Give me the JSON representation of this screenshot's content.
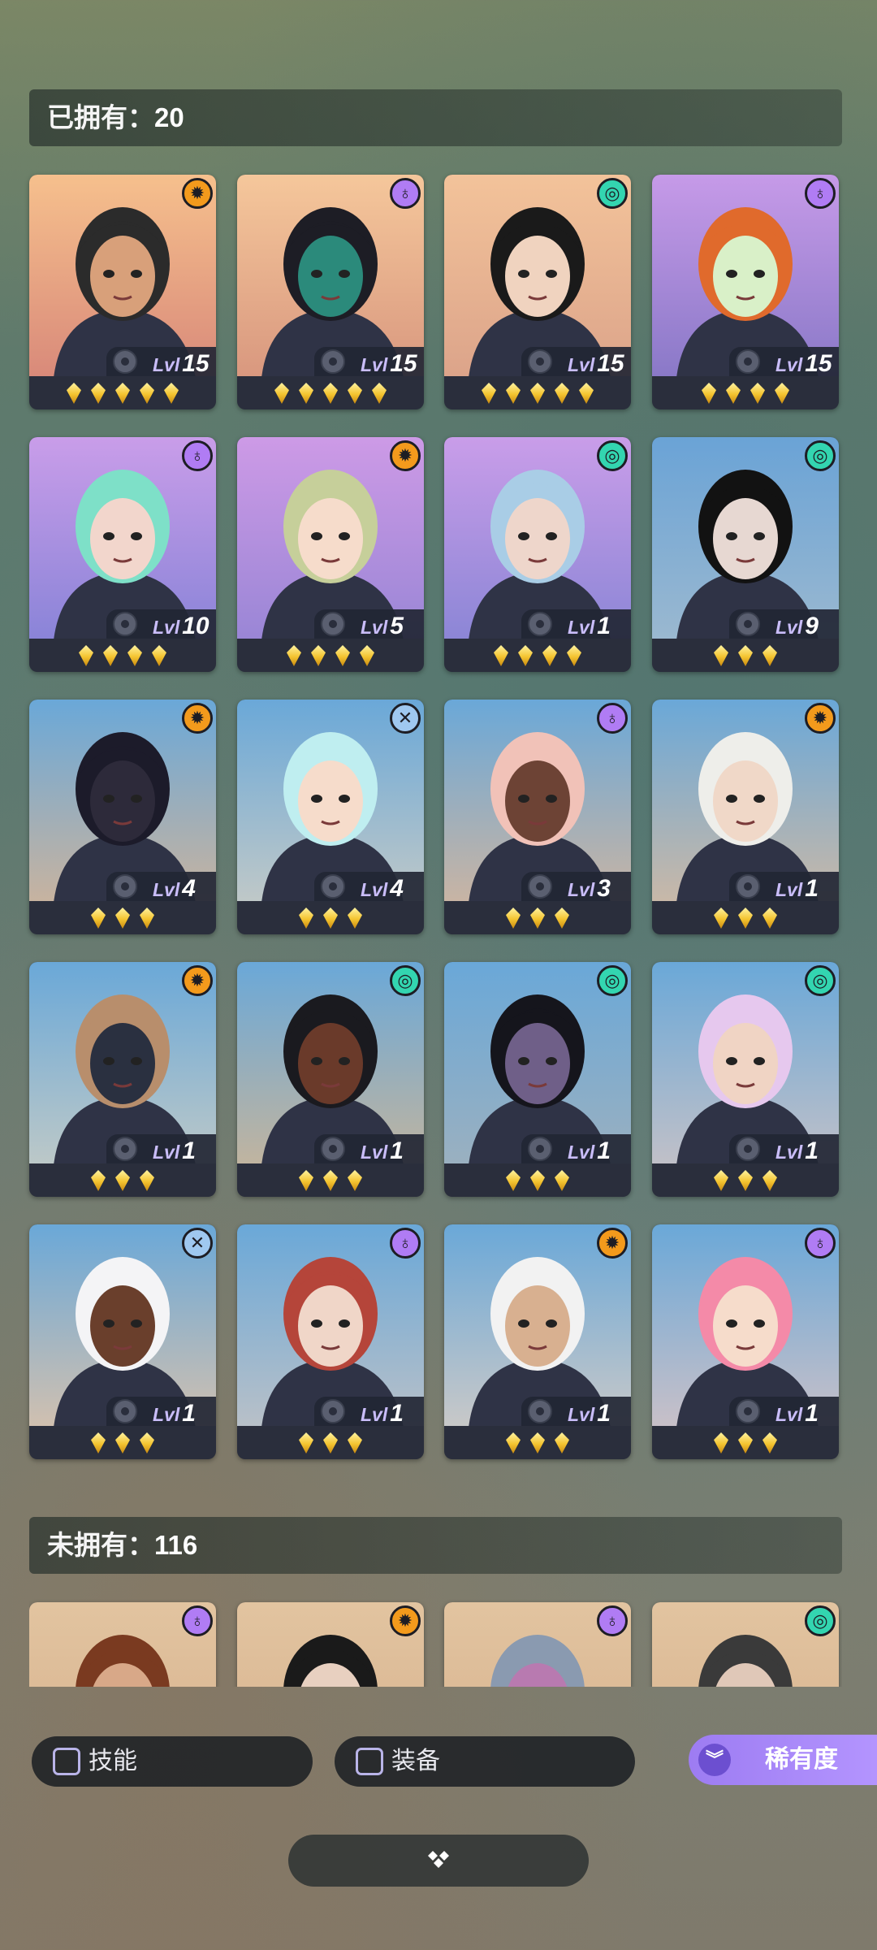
{
  "owned": {
    "label": "已拥有：",
    "count": "20"
  },
  "not_owned": {
    "label": "未拥有：",
    "count": "116"
  },
  "lvl_prefix": "Lvl",
  "owned_heroes": [
    {
      "level": "15",
      "stars": 5,
      "cls": "sun",
      "name_icon": "sun-class-icon",
      "bg": [
        "#f6c08d",
        "#d98a7a"
      ],
      "hair": "#2b2b2b",
      "skin": "#d8a07a"
    },
    {
      "level": "15",
      "stars": 5,
      "cls": "mask",
      "name_icon": "mask-class-icon",
      "bg": [
        "#f5c79b",
        "#d9987f"
      ],
      "hair": "#1d1d25",
      "skin": "#2b8a7b"
    },
    {
      "level": "15",
      "stars": 5,
      "cls": "swirl",
      "name_icon": "swirl-class-icon",
      "bg": [
        "#f3c39a",
        "#dca48a"
      ],
      "hair": "#1a1a1a",
      "skin": "#f0d3bf"
    },
    {
      "level": "15",
      "stars": 4,
      "cls": "mask",
      "name_icon": "mask-class-icon",
      "bg": [
        "#c69ae8",
        "#8a79c8"
      ],
      "hair": "#e06a2c",
      "skin": "#d9f0c8"
    },
    {
      "level": "10",
      "stars": 4,
      "cls": "mask",
      "name_icon": "mask-class-icon",
      "bg": [
        "#c99de9",
        "#8a84d8"
      ],
      "hair": "#7ee0c8",
      "skin": "#f2d6cc"
    },
    {
      "level": "5",
      "stars": 4,
      "cls": "sun",
      "name_icon": "sun-class-icon",
      "bg": [
        "#cd9ae6",
        "#9a86d6"
      ],
      "hair": "#c6cf9a",
      "skin": "#f6dccb"
    },
    {
      "level": "1",
      "stars": 4,
      "cls": "swirl",
      "name_icon": "swirl-class-icon",
      "bg": [
        "#c99de9",
        "#8c86d6"
      ],
      "hair": "#a9cde6",
      "skin": "#eed6cb"
    },
    {
      "level": "9",
      "stars": 3,
      "cls": "swirl",
      "name_icon": "swirl-class-icon",
      "bg": [
        "#6aa3d6",
        "#9ab8d0"
      ],
      "hair": "#121212",
      "skin": "#e7d8d2"
    },
    {
      "level": "4",
      "stars": 3,
      "cls": "sun",
      "name_icon": "sun-class-icon",
      "bg": [
        "#6aa8d8",
        "#c7b3a0"
      ],
      "hair": "#1c1b2a",
      "skin": "#2d2a3a"
    },
    {
      "level": "4",
      "stars": 3,
      "cls": "cross",
      "name_icon": "cross-class-icon",
      "bg": [
        "#6aa8d8",
        "#bfc8c8"
      ],
      "hair": "#bfeef0",
      "skin": "#f6dccb"
    },
    {
      "level": "3",
      "stars": 3,
      "cls": "mask",
      "name_icon": "mask-class-icon",
      "bg": [
        "#6aa8d8",
        "#c8b4a4"
      ],
      "hair": "#f1c2b8",
      "skin": "#6d4335"
    },
    {
      "level": "1",
      "stars": 3,
      "cls": "sun",
      "name_icon": "sun-class-icon",
      "bg": [
        "#6aa8d8",
        "#c8b8a8"
      ],
      "hair": "#eeeeea",
      "skin": "#f0d8c8"
    },
    {
      "level": "1",
      "stars": 3,
      "cls": "sun",
      "name_icon": "sun-class-icon",
      "bg": [
        "#6aa8d8",
        "#bcc8c8"
      ],
      "hair": "#b88e6c",
      "skin": "#2a3040"
    },
    {
      "level": "1",
      "stars": 3,
      "cls": "swirl",
      "name_icon": "swirl-class-icon",
      "bg": [
        "#6aa8d8",
        "#c0b4a0"
      ],
      "hair": "#1a1a1f",
      "skin": "#6a3a2a"
    },
    {
      "level": "1",
      "stars": 3,
      "cls": "swirl",
      "name_icon": "swirl-class-icon",
      "bg": [
        "#6aa8d8",
        "#9ab0c0"
      ],
      "hair": "#15151c",
      "skin": "#6f5f88"
    },
    {
      "level": "1",
      "stars": 3,
      "cls": "swirl",
      "name_icon": "swirl-class-icon",
      "bg": [
        "#6aa8d8",
        "#c0c0c8"
      ],
      "hair": "#e6c8ee",
      "skin": "#f0d4c4"
    },
    {
      "level": "1",
      "stars": 3,
      "cls": "cross",
      "name_icon": "cross-class-icon",
      "bg": [
        "#6aa8d8",
        "#d0c0b0"
      ],
      "hair": "#f4f4f6",
      "skin": "#6a3f2c"
    },
    {
      "level": "1",
      "stars": 3,
      "cls": "mask",
      "name_icon": "mask-class-icon",
      "bg": [
        "#6aa8d8",
        "#b8c0c8"
      ],
      "hair": "#b5453a",
      "skin": "#f0d6c8"
    },
    {
      "level": "1",
      "stars": 3,
      "cls": "sun",
      "name_icon": "sun-class-icon",
      "bg": [
        "#6aa8d8",
        "#c8c8c8"
      ],
      "hair": "#f2f2f2",
      "skin": "#d8b090"
    },
    {
      "level": "1",
      "stars": 3,
      "cls": "mask",
      "name_icon": "mask-class-icon",
      "bg": [
        "#6aa8d8",
        "#c8c0c8"
      ],
      "hair": "#f48aa8",
      "skin": "#f6dccb"
    }
  ],
  "unowned_heroes": [
    {
      "cls": "mask",
      "name_icon": "mask-class-icon",
      "bg": [
        "#e2c4a0",
        "#d6b08c"
      ],
      "hair": "#7a3a20",
      "skin": "#d8a888"
    },
    {
      "cls": "sun",
      "name_icon": "sun-class-icon",
      "bg": [
        "#e2c4a0",
        "#d6b08c"
      ],
      "hair": "#1a1a1a",
      "skin": "#e8d0c0"
    },
    {
      "cls": "mask",
      "name_icon": "mask-class-icon",
      "bg": [
        "#e2c4a0",
        "#d6b08c"
      ],
      "hair": "#8a9ab0",
      "skin": "#b87ab0"
    },
    {
      "cls": "swirl",
      "name_icon": "swirl-class-icon",
      "bg": [
        "#e2c4a0",
        "#d6b08c"
      ],
      "hair": "#3a3a3a",
      "skin": "#e0c8b8"
    }
  ],
  "filters": {
    "skill": "技能",
    "equipment": "装备",
    "rarity": "稀有度"
  },
  "colors": {
    "accent": "#a585f5",
    "card_bg": "#2a2e3c",
    "gem": "#f4c430"
  }
}
